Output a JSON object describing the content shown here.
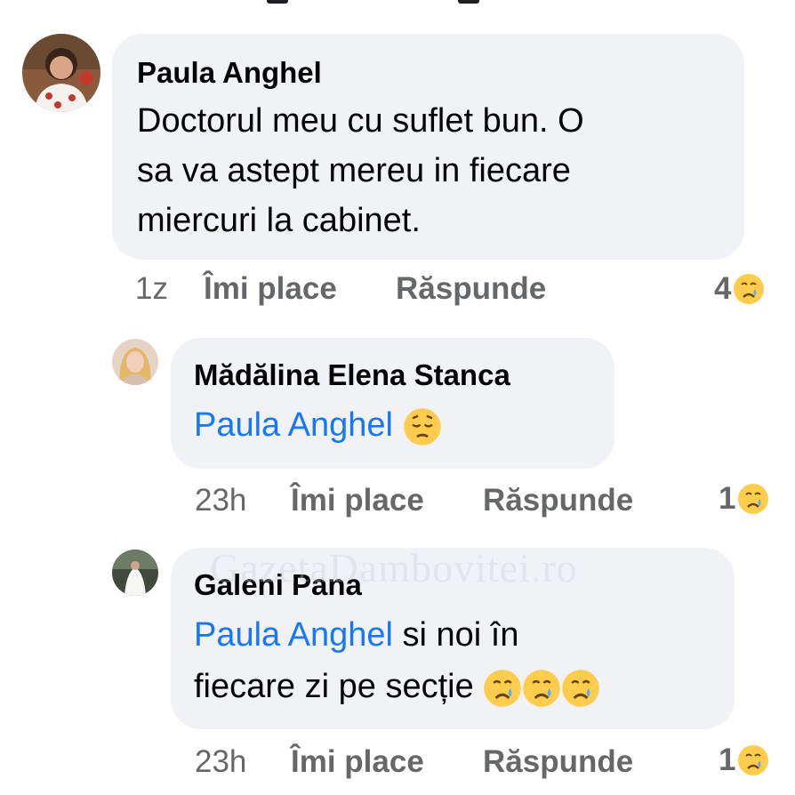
{
  "comments": [
    {
      "author": "Paula Anghel",
      "text_lines": [
        "Doctorul meu cu suflet bun. O",
        "sa va astept mereu in fiecare",
        "miercuri la cabinet."
      ],
      "time": "1z",
      "like_label": "Îmi place",
      "reply_label": "Răspunde",
      "reaction_count": "4",
      "reaction_icon": "crying-face-icon"
    },
    {
      "author": "Mădălina Elena Stanca",
      "mention": "Paula Anghel",
      "text_after_mention": "",
      "emoji": "pensive-face-icon",
      "time": "23h",
      "like_label": "Îmi place",
      "reply_label": "Răspunde",
      "reaction_count": "1",
      "reaction_icon": "crying-face-icon"
    },
    {
      "author": "Galeni Pana",
      "mention": "Paula Anghel",
      "text_after_mention": " si noi în",
      "text_line2": "fiecare zi pe secție",
      "emojis": [
        "crying-face-icon",
        "crying-face-icon",
        "crying-face-icon"
      ],
      "time": "23h",
      "like_label": "Îmi place",
      "reply_label": "Răspunde",
      "reaction_count": "1",
      "reaction_icon": "crying-face-icon"
    }
  ],
  "watermark": "GazetaDambovitei.ro",
  "colors": {
    "bubble": "#f0f2f5",
    "mention": "#1877f2",
    "meta": "#65676b",
    "text": "#050505"
  }
}
